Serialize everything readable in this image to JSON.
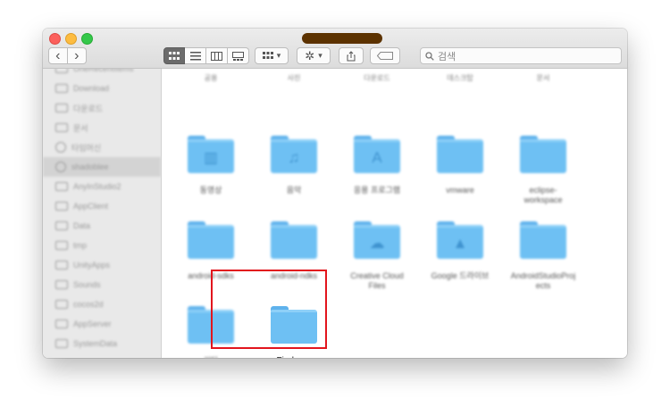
{
  "window": {
    "title": "",
    "search_placeholder": "검색"
  },
  "toolbar": {
    "back_glyph": "‹",
    "forward_glyph": "›",
    "views": [
      "icon-view",
      "list-view",
      "column-view",
      "gallery-view"
    ],
    "arrange_glyph": "▾",
    "action_glyph": "▾"
  },
  "sidebar": {
    "items": [
      {
        "label": "OneRecentItems",
        "icon": "folder-icon"
      },
      {
        "label": "Download",
        "icon": "folder-icon"
      },
      {
        "label": "다운로드",
        "icon": "folder-icon"
      },
      {
        "label": "문서",
        "icon": "folder-icon"
      },
      {
        "label": "타임머신",
        "icon": "gear-icon"
      },
      {
        "label": "shadoblee",
        "icon": "gear-icon",
        "selected": true
      },
      {
        "label": "AnyInStudio2",
        "icon": "folder-icon"
      },
      {
        "label": "AppClient",
        "icon": "folder-icon"
      },
      {
        "label": "Data",
        "icon": "folder-icon"
      },
      {
        "label": "tmp",
        "icon": "folder-icon"
      },
      {
        "label": "UnityApps",
        "icon": "folder-icon"
      },
      {
        "label": "Sounds",
        "icon": "folder-icon"
      },
      {
        "label": "cocos2d",
        "icon": "folder-icon"
      },
      {
        "label": "AppServer",
        "icon": "folder-icon"
      },
      {
        "label": "SystemData",
        "icon": "folder-icon"
      }
    ]
  },
  "top_labels": [
    "공용",
    "사진",
    "다운로드",
    "데스크탑",
    "문서"
  ],
  "folders": [
    {
      "label": "동영상",
      "glyph": "film-icon"
    },
    {
      "label": "음악",
      "glyph": "music-icon"
    },
    {
      "label": "응용 프로그램",
      "glyph": "apps-icon"
    },
    {
      "label": "vmware",
      "glyph": ""
    },
    {
      "label": "eclipse-",
      "label2": "workspace",
      "glyph": ""
    },
    {
      "label": "android-sdks",
      "glyph": ""
    },
    {
      "label": "android-ndks",
      "glyph": ""
    },
    {
      "label": "Creative Cloud",
      "label2": "Files",
      "glyph": "cloud-icon"
    },
    {
      "label": "Google 드라이브",
      "glyph": "drive-icon"
    },
    {
      "label": "AndroidStudioProj",
      "label2": "ects",
      "glyph": ""
    },
    {
      "label": "기타",
      "glyph": ""
    },
    {
      "label": "Firebase",
      "glyph": "",
      "highlighted": true
    }
  ],
  "colors": {
    "folder": "#6ec0f3",
    "highlight": "#e2151d",
    "title_pill": "#5c3200"
  }
}
